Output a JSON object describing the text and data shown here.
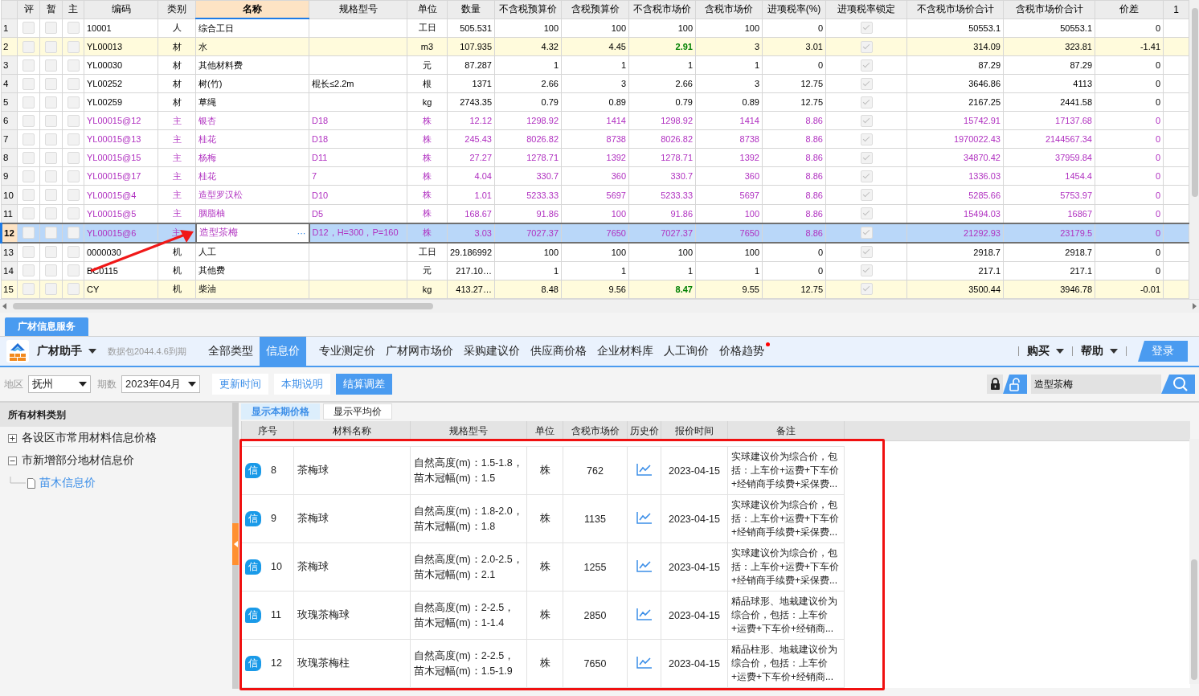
{
  "grid": {
    "columns": [
      {
        "label": "评",
        "selected": false
      },
      {
        "label": "暂",
        "selected": false
      },
      {
        "label": "主",
        "selected": false
      },
      {
        "label": "编码",
        "selected": false
      },
      {
        "label": "类别",
        "selected": false
      },
      {
        "label": "名称",
        "selected": true
      },
      {
        "label": "规格型号",
        "selected": false
      },
      {
        "label": "单位",
        "selected": false
      },
      {
        "label": "数量",
        "selected": false
      },
      {
        "label": "不含税预算价",
        "selected": false
      },
      {
        "label": "含税预算价",
        "selected": false
      },
      {
        "label": "不含税市场价",
        "selected": false
      },
      {
        "label": "含税市场价",
        "selected": false
      },
      {
        "label": "进项税率(%)",
        "selected": false
      },
      {
        "label": "进项税率锁定",
        "selected": false
      },
      {
        "label": "不含税市场价合计",
        "selected": false
      },
      {
        "label": "含税市场价合计",
        "selected": false
      },
      {
        "label": "价差",
        "selected": false
      },
      {
        "label": "1",
        "selected": false
      }
    ],
    "editor_button": "···",
    "rows": [
      {
        "no": "1",
        "checks": [
          false,
          false,
          false
        ],
        "code": "10001",
        "type": "人",
        "name": "综合工日",
        "unit": "工日",
        "qty": "505.531",
        "budget_ex": "100",
        "budget_in": "100",
        "market_ex": "100",
        "market_in": "100",
        "rate": "0",
        "rate_locked": true,
        "total_ex": "50553.1",
        "total_in": "50553.1",
        "diff": "0",
        "kind": "plain",
        "flagged": false,
        "selected": false,
        "price_changed": false
      },
      {
        "no": "2",
        "checks": [
          false,
          false,
          false
        ],
        "code": "YL00013",
        "type": "材",
        "name": "水",
        "unit": "m3",
        "qty": "107.935",
        "budget_ex": "4.32",
        "budget_in": "4.45",
        "market_ex": "2.91",
        "market_in": "3",
        "rate": "3.01",
        "rate_locked": true,
        "total_ex": "314.09",
        "total_in": "323.81",
        "diff": "-1.41",
        "kind": "plain",
        "flagged": true,
        "selected": false,
        "price_changed": true
      },
      {
        "no": "3",
        "checks": [
          false,
          false,
          false
        ],
        "code": "YL00030",
        "type": "材",
        "name": "其他材料费",
        "unit": "元",
        "qty": "87.287",
        "budget_ex": "1",
        "budget_in": "1",
        "market_ex": "1",
        "market_in": "1",
        "rate": "0",
        "rate_locked": true,
        "total_ex": "87.29",
        "total_in": "87.29",
        "diff": "0",
        "kind": "plain",
        "flagged": false,
        "selected": false,
        "price_changed": false
      },
      {
        "no": "4",
        "checks": [
          false,
          false,
          false
        ],
        "code": "YL00252",
        "type": "材",
        "name": "树(竹)",
        "spec": "棍长≤2.2m",
        "unit": "根",
        "qty": "1371",
        "budget_ex": "2.66",
        "budget_in": "3",
        "market_ex": "2.66",
        "market_in": "3",
        "rate": "12.75",
        "rate_locked": true,
        "total_ex": "3646.86",
        "total_in": "4113",
        "diff": "0",
        "kind": "plain",
        "flagged": false,
        "selected": false,
        "price_changed": false
      },
      {
        "no": "5",
        "checks": [
          false,
          false,
          false
        ],
        "code": "YL00259",
        "type": "材",
        "name": "草绳",
        "unit": "kg",
        "qty": "2743.35",
        "budget_ex": "0.79",
        "budget_in": "0.89",
        "market_ex": "0.79",
        "market_in": "0.89",
        "rate": "12.75",
        "rate_locked": true,
        "total_ex": "2167.25",
        "total_in": "2441.58",
        "diff": "0",
        "kind": "plain",
        "flagged": false,
        "selected": false,
        "price_changed": false
      },
      {
        "no": "6",
        "checks": [
          false,
          false,
          false
        ],
        "code": "YL00015@12",
        "type": "主",
        "name": "银杏",
        "spec": "D18",
        "unit": "株",
        "qty": "12.12",
        "budget_ex": "1298.92",
        "budget_in": "1414",
        "market_ex": "1298.92",
        "market_in": "1414",
        "rate": "8.86",
        "rate_locked": true,
        "total_ex": "15742.91",
        "total_in": "17137.68",
        "diff": "0",
        "kind": "main",
        "flagged": false,
        "selected": false,
        "price_changed": false
      },
      {
        "no": "7",
        "checks": [
          false,
          false,
          false
        ],
        "code": "YL00015@13",
        "type": "主",
        "name": "桂花",
        "spec": "D18",
        "unit": "株",
        "qty": "245.43",
        "budget_ex": "8026.82",
        "budget_in": "8738",
        "market_ex": "8026.82",
        "market_in": "8738",
        "rate": "8.86",
        "rate_locked": true,
        "total_ex": "1970022.43",
        "total_in": "2144567.34",
        "diff": "0",
        "kind": "main",
        "flagged": false,
        "selected": false,
        "price_changed": false
      },
      {
        "no": "8",
        "checks": [
          false,
          false,
          false
        ],
        "code": "YL00015@15",
        "type": "主",
        "name": "杨梅",
        "spec": "D11",
        "unit": "株",
        "qty": "27.27",
        "budget_ex": "1278.71",
        "budget_in": "1392",
        "market_ex": "1278.71",
        "market_in": "1392",
        "rate": "8.86",
        "rate_locked": true,
        "total_ex": "34870.42",
        "total_in": "37959.84",
        "diff": "0",
        "kind": "main",
        "flagged": false,
        "selected": false,
        "price_changed": false
      },
      {
        "no": "9",
        "checks": [
          false,
          false,
          false
        ],
        "code": "YL00015@17",
        "type": "主",
        "name": "桂花",
        "spec": "7",
        "unit": "株",
        "qty": "4.04",
        "budget_ex": "330.7",
        "budget_in": "360",
        "market_ex": "330.7",
        "market_in": "360",
        "rate": "8.86",
        "rate_locked": true,
        "total_ex": "1336.03",
        "total_in": "1454.4",
        "diff": "0",
        "kind": "main",
        "flagged": false,
        "selected": false,
        "price_changed": false
      },
      {
        "no": "10",
        "checks": [
          false,
          false,
          false
        ],
        "code": "YL00015@4",
        "type": "主",
        "name": "造型罗汉松",
        "spec": "D10",
        "unit": "株",
        "qty": "1.01",
        "budget_ex": "5233.33",
        "budget_in": "5697",
        "market_ex": "5233.33",
        "market_in": "5697",
        "rate": "8.86",
        "rate_locked": true,
        "total_ex": "5285.66",
        "total_in": "5753.97",
        "diff": "0",
        "kind": "main",
        "flagged": false,
        "selected": false,
        "price_changed": false
      },
      {
        "no": "11",
        "checks": [
          false,
          false,
          false
        ],
        "code": "YL00015@5",
        "type": "主",
        "name": "胭脂柚",
        "spec": "D5",
        "unit": "株",
        "qty": "168.67",
        "budget_ex": "91.86",
        "budget_in": "100",
        "market_ex": "91.86",
        "market_in": "100",
        "rate": "8.86",
        "rate_locked": true,
        "total_ex": "15494.03",
        "total_in": "16867",
        "diff": "0",
        "kind": "main",
        "flagged": false,
        "selected": false,
        "price_changed": false
      },
      {
        "no": "12",
        "checks": [
          false,
          false,
          false
        ],
        "code": "YL00015@6",
        "type": "主",
        "name": "造型茶梅",
        "spec": "D12，H=300，P=160",
        "unit": "株",
        "qty": "3.03",
        "budget_ex": "7027.37",
        "budget_in": "7650",
        "market_ex": "7027.37",
        "market_in": "7650",
        "rate": "8.86",
        "rate_locked": true,
        "total_ex": "21292.93",
        "total_in": "23179.5",
        "diff": "0",
        "kind": "main",
        "flagged": false,
        "selected": true,
        "price_changed": false
      },
      {
        "no": "13",
        "checks": [
          false,
          false,
          false
        ],
        "code": "0000030",
        "type": "机",
        "name": "人工",
        "unit": "工日",
        "qty": "29.186992",
        "budget_ex": "100",
        "budget_in": "100",
        "market_ex": "100",
        "market_in": "100",
        "rate": "0",
        "rate_locked": true,
        "total_ex": "2918.7",
        "total_in": "2918.7",
        "diff": "0",
        "kind": "plain",
        "flagged": false,
        "selected": false,
        "price_changed": false
      },
      {
        "no": "14",
        "checks": [
          false,
          false,
          false
        ],
        "code": "BC0115",
        "type": "机",
        "name": "其他费",
        "unit": "元",
        "qty": "217.10…",
        "budget_ex": "1",
        "budget_in": "1",
        "market_ex": "1",
        "market_in": "1",
        "rate": "0",
        "rate_locked": true,
        "total_ex": "217.1",
        "total_in": "217.1",
        "diff": "0",
        "kind": "plain",
        "flagged": false,
        "selected": false,
        "price_changed": false
      },
      {
        "no": "15",
        "checks": [
          false,
          false,
          false
        ],
        "code": "CY",
        "type": "机",
        "name": "柴油",
        "unit": "kg",
        "qty": "413.27…",
        "budget_ex": "8.48",
        "budget_in": "9.56",
        "market_ex": "8.47",
        "market_in": "9.55",
        "rate": "12.75",
        "rate_locked": true,
        "total_ex": "3500.44",
        "total_in": "3946.78",
        "diff": "-0.01",
        "kind": "plain",
        "flagged": true,
        "selected": false,
        "price_changed": true
      }
    ]
  },
  "service": {
    "tab": "广材信息服务",
    "app_name": "广材助手",
    "data_notice": "数据包2044.4.6到期",
    "nav": [
      {
        "label": "全部类型",
        "selected": false,
        "notify": false
      },
      {
        "label": "信息价",
        "selected": true,
        "notify": false
      },
      {
        "label": "专业测定价",
        "selected": false,
        "notify": false
      },
      {
        "label": "广材网市场价",
        "selected": false,
        "notify": false
      },
      {
        "label": "采购建议价",
        "selected": false,
        "notify": false
      },
      {
        "label": "供应商价格",
        "selected": false,
        "notify": false
      },
      {
        "label": "企业材料库",
        "selected": false,
        "notify": false
      },
      {
        "label": "人工询价",
        "selected": false,
        "notify": false
      },
      {
        "label": "价格趋势",
        "selected": false,
        "notify": true
      }
    ],
    "menus": [
      "购买",
      "帮助"
    ],
    "login": "登录",
    "filters": {
      "region_label": "地区",
      "region": "抚州",
      "period_label": "期数",
      "period": "2023年04月",
      "buttons": [
        {
          "label": "更新时间",
          "selected": false
        },
        {
          "label": "本期说明",
          "selected": false
        },
        {
          "label": "结算调差",
          "selected": true
        }
      ],
      "search": {
        "value": "造型茶梅"
      }
    }
  },
  "categories": {
    "title": "所有材料类别",
    "items": [
      {
        "label": "各设区市常用材料信息价格",
        "expanded": false,
        "selected": false
      },
      {
        "label": "市新增部分地材信息价",
        "expanded": true,
        "selected": false,
        "children": [
          {
            "label": "苗木信息价",
            "selected": true
          }
        ]
      }
    ]
  },
  "prices": {
    "views": [
      {
        "label": "显示本期价格",
        "selected": true
      },
      {
        "label": "显示平均价",
        "selected": false
      }
    ],
    "columns": [
      "序号",
      "材料名称",
      "规格型号",
      "单位",
      "含税市场价",
      "历史价",
      "报价时间",
      "备注"
    ],
    "rows": [
      {
        "badge": "信",
        "no": "8",
        "name": "茶梅球",
        "spec": "自然高度(m)：1.5-1.8，苗木冠幅(m)：1.5",
        "unit": "株",
        "price": "762",
        "date": "2023-04-15",
        "note": "实球建议价为综合价，包括：上车价+运费+下车价+经销商手续费+采保费..."
      },
      {
        "badge": "信",
        "no": "9",
        "name": "茶梅球",
        "spec": "自然高度(m)：1.8-2.0，苗木冠幅(m)：1.8",
        "unit": "株",
        "price": "1135",
        "date": "2023-04-15",
        "note": "实球建议价为综合价，包括：上车价+运费+下车价+经销商手续费+采保费..."
      },
      {
        "badge": "信",
        "no": "10",
        "name": "茶梅球",
        "spec": "自然高度(m)：2.0-2.5，苗木冠幅(m)：2.1",
        "unit": "株",
        "price": "1255",
        "date": "2023-04-15",
        "note": "实球建议价为综合价，包括：上车价+运费+下车价+经销商手续费+采保费..."
      },
      {
        "badge": "信",
        "no": "11",
        "name": "玫瑰茶梅球",
        "spec": "自然高度(m)：2-2.5，苗木冠幅(m)：1-1.4",
        "unit": "株",
        "price": "2850",
        "date": "2023-04-15",
        "note": "精品球形、地栽建议价为综合价，包括：上车价+运费+下车价+经销商..."
      },
      {
        "badge": "信",
        "no": "12",
        "name": "玫瑰茶梅柱",
        "spec": "自然高度(m)：2-2.5，苗木冠幅(m)：1.5-1.9",
        "unit": "株",
        "price": "7650",
        "date": "2023-04-15",
        "note": "精品柱形、地栽建议价为综合价，包括：上车价+运费+下车价+经销商..."
      }
    ]
  }
}
